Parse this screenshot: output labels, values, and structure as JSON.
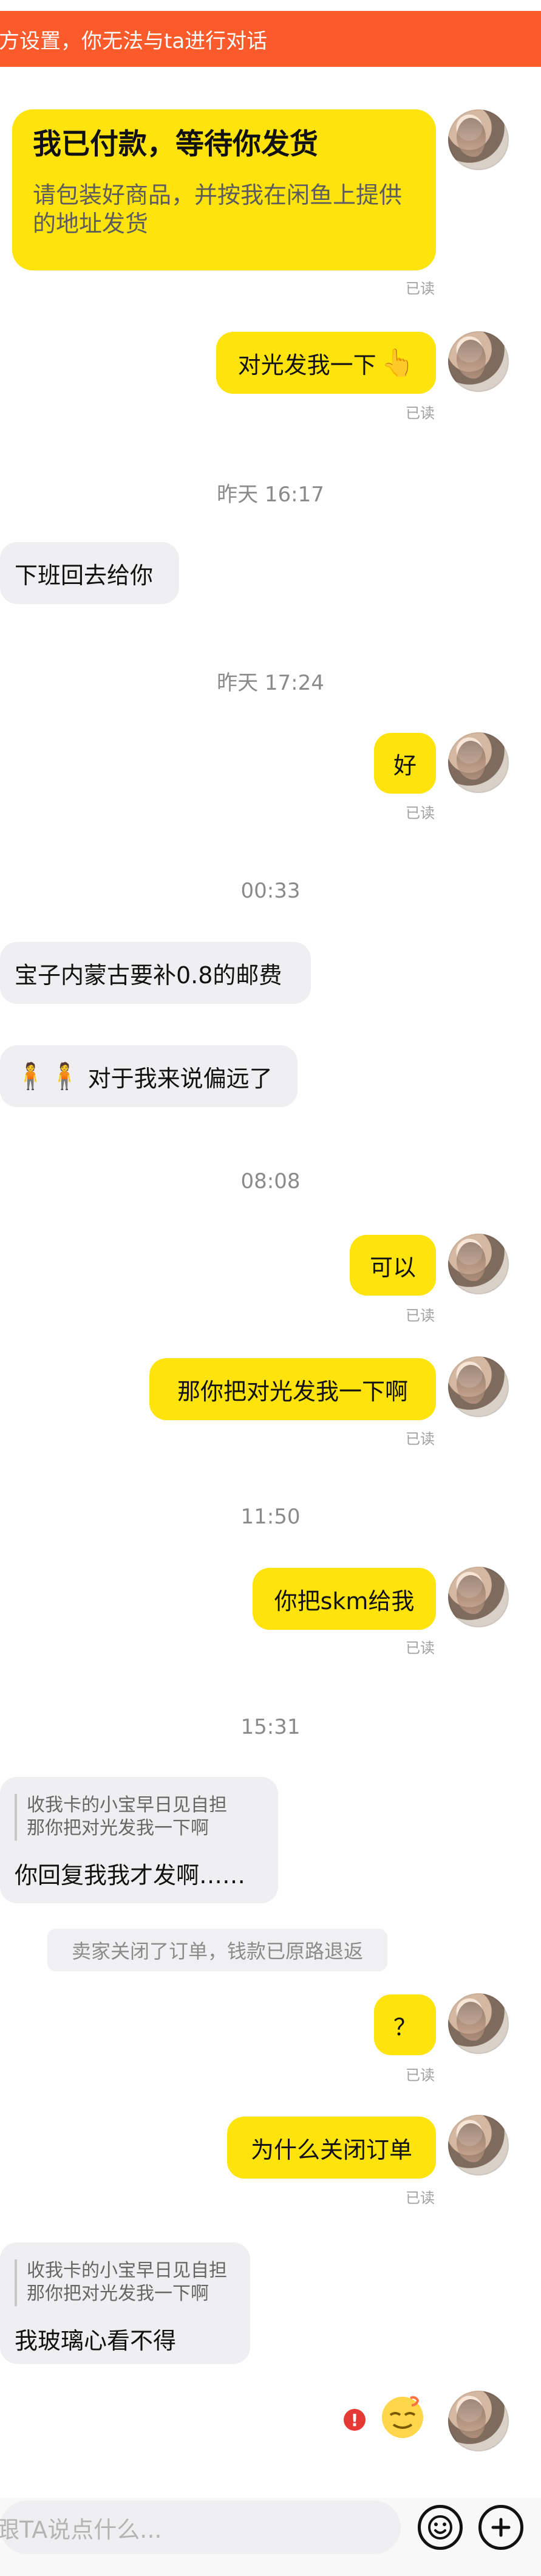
{
  "banner": {
    "text": "方设置，你无法与ta进行对话"
  },
  "messages": {
    "card": {
      "title": "我已付款，等待你发货",
      "body": "请包装好商品，并按我在闲鱼上提供的地址发货"
    },
    "read1": "已读",
    "msg1": "对光发我一下",
    "read2": "已读",
    "time1": "昨天 16:17",
    "left1": "下班回去给你",
    "time2": "昨天 17:24",
    "msg2": "好",
    "read3": "已读",
    "time3": "00:33",
    "left2": "宝子内蒙古要补0.8的邮费",
    "left3": "对于我来说偏远了",
    "time4": "08:08",
    "msg3": "可以",
    "read4": "已读",
    "msg4": "那你把对光发我一下啊",
    "read5": "已读",
    "time5": "11:50",
    "msg5": "你把skm给我",
    "read6": "已读",
    "time6": "15:31",
    "quote1": {
      "ref_line1": "收我卡的小宝早日见自担",
      "ref_line2": "那你把对光发我一下啊",
      "main": "你回复我我才发啊……"
    },
    "system_note": "卖家关闭了订单，钱款已原路退返",
    "msg6": "？",
    "read7": "已读",
    "msg7": "为什么关闭订单",
    "read8": "已读",
    "quote2": {
      "ref_line1": "收我卡的小宝早日见自担",
      "ref_line2": "那你把对光发我一下啊",
      "main": "我玻璃心看不得"
    },
    "alert_text": "!"
  },
  "input": {
    "placeholder": "跟TA说点什么..."
  }
}
